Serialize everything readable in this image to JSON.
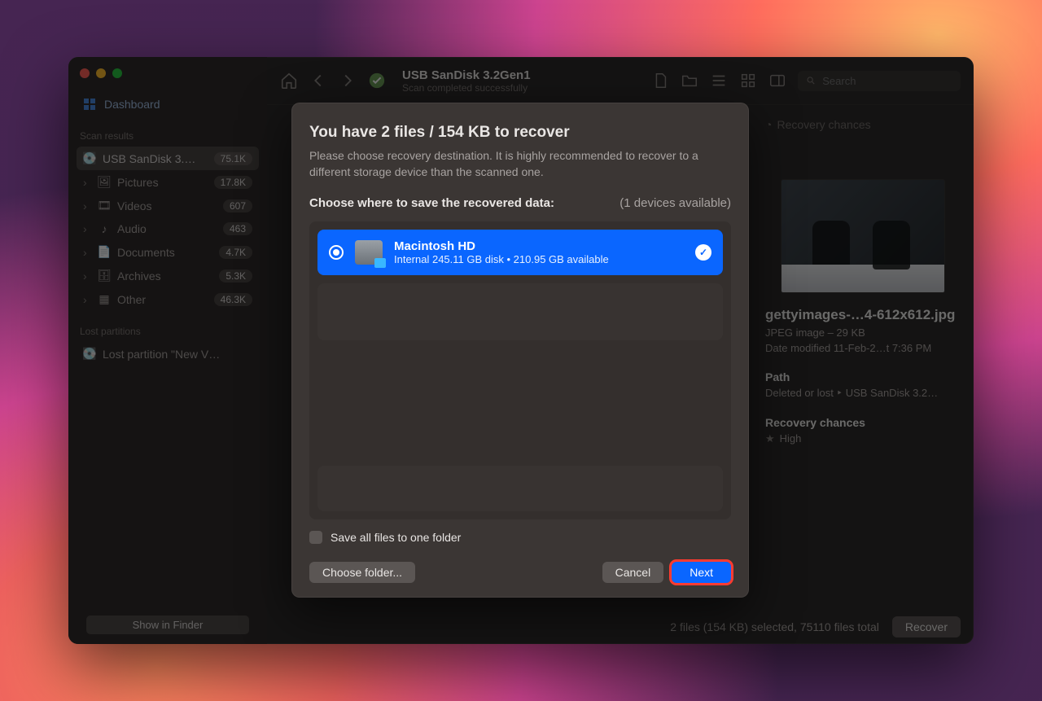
{
  "header": {
    "title": "USB  SanDisk 3.2Gen1",
    "subtitle": "Scan completed successfully",
    "search_placeholder": "Search"
  },
  "sidebar": {
    "dashboard_label": "Dashboard",
    "section_scan_results": "Scan results",
    "section_lost_partitions": "Lost partitions",
    "items": [
      {
        "label": "USB  SanDisk 3.…",
        "count": "75.1K"
      },
      {
        "label": "Pictures",
        "count": "17.8K"
      },
      {
        "label": "Videos",
        "count": "607"
      },
      {
        "label": "Audio",
        "count": "463"
      },
      {
        "label": "Documents",
        "count": "4.7K"
      },
      {
        "label": "Archives",
        "count": "5.3K"
      },
      {
        "label": "Other",
        "count": "46.3K"
      }
    ],
    "lost_partition_label": "Lost partition \"New V…",
    "show_in_finder": "Show in Finder"
  },
  "tabs": {
    "recovery_chances": "Recovery chances"
  },
  "inspector": {
    "filename": "gettyimages-…4-612x612.jpg",
    "meta1": "JPEG image – 29 KB",
    "meta2": "Date modified  11-Feb-2…t 7:36 PM",
    "path_label": "Path",
    "path_value": "Deleted or lost ‣ USB  SanDisk 3.2…",
    "chances_label": "Recovery chances",
    "chances_value": "High"
  },
  "status": {
    "summary": "2 files (154 KB) selected, 75110 files total",
    "recover_label": "Recover"
  },
  "dialog": {
    "title": "You have 2 files / 154 KB to recover",
    "subtitle": "Please choose recovery destination. It is highly recommended to recover to a different storage device than the scanned one.",
    "choose_label": "Choose where to save the recovered data:",
    "devices_available": "(1 devices available)",
    "destinations": [
      {
        "name": "Macintosh HD",
        "detail": "Internal 245.11 GB disk • 210.95 GB available"
      }
    ],
    "save_to_one_folder": "Save all files to one folder",
    "choose_folder": "Choose folder...",
    "cancel": "Cancel",
    "next": "Next"
  }
}
